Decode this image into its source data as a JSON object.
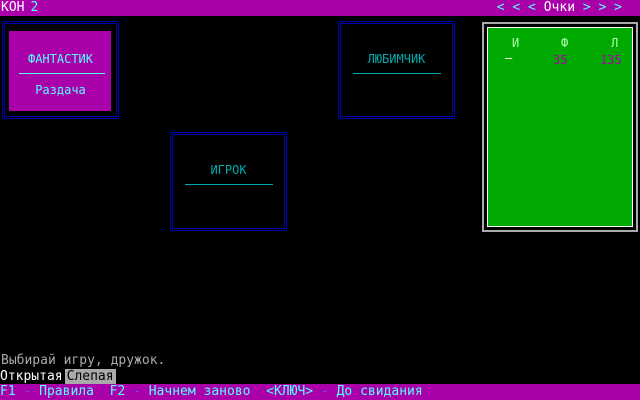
{
  "header": {
    "title": "КОН",
    "round": "2",
    "score_label": "Очки",
    "left_arrows": "< < <",
    "right_arrows": "> > >"
  },
  "players": [
    {
      "name": "ФАНТАСТИК",
      "action": "Раздача",
      "active": true
    },
    {
      "name": "ЛЮБИМЧИК",
      "action": "",
      "active": false
    },
    {
      "name": "ИГРОК",
      "action": "",
      "active": false
    }
  ],
  "scoreboard": {
    "headers": [
      "И",
      "Ф",
      "Л"
    ],
    "row": [
      "—",
      "35",
      "135"
    ]
  },
  "message": "Выбирай игру, дружок.",
  "modes": {
    "open": "Открытая",
    "blind": "Слепая",
    "selected": "Слепая"
  },
  "footer": {
    "f1_key": "F1",
    "f1_sep": " - ",
    "f1_label": "Правила",
    "f2_key": "F2",
    "f2_sep": " - ",
    "f2_label": "Начнем заново",
    "esc_key": "<КЛЮЧ>",
    "esc_sep": " - ",
    "esc_label": "До свидания"
  },
  "colors": {
    "bar": "#aa00aa",
    "table_green": "#00aa00",
    "panel_border": "#0000aa",
    "label_cyan": "#00aaaa"
  }
}
